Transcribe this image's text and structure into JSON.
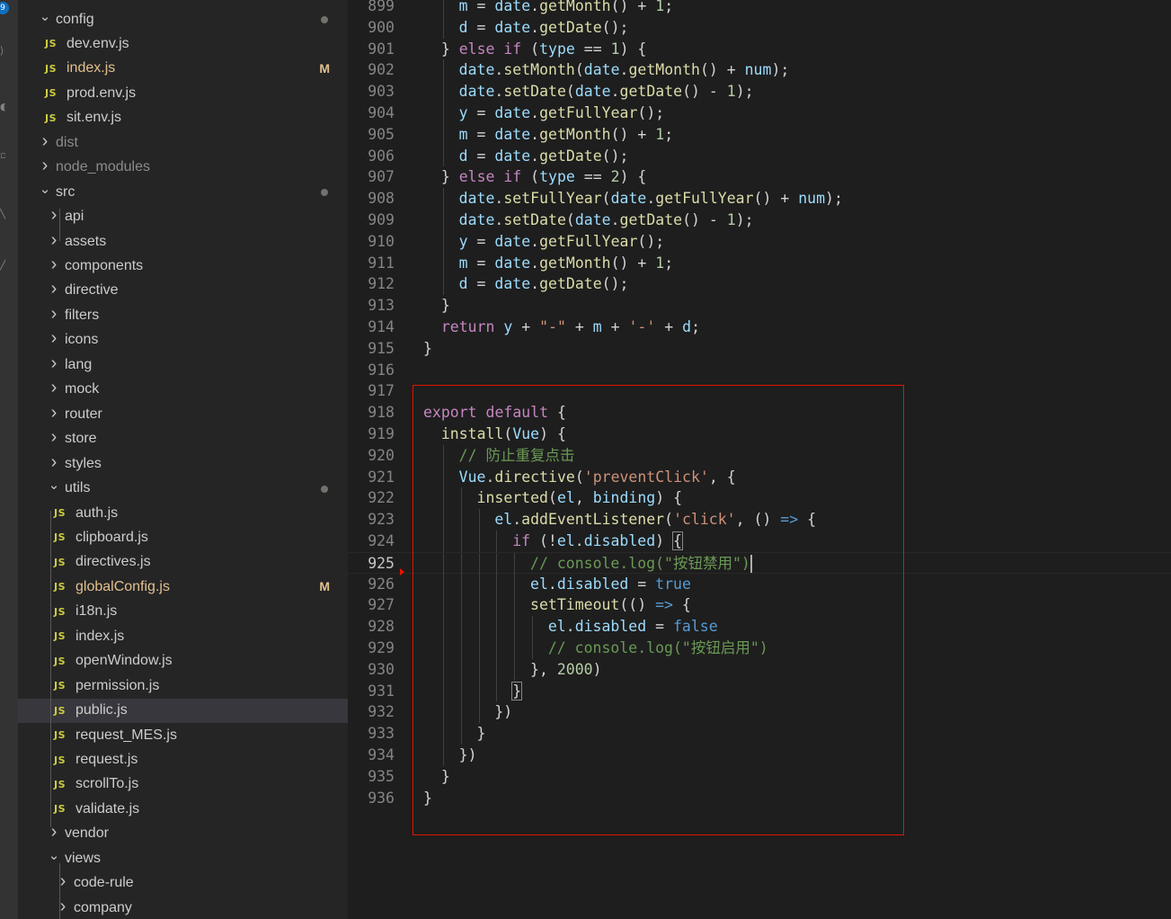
{
  "activity_bar": {
    "badge": "9"
  },
  "explorer": {
    "rows": [
      {
        "label": "config",
        "type": "folder-open",
        "depth": 1,
        "dot": true
      },
      {
        "label": "dev.env.js",
        "type": "js",
        "depth": 2
      },
      {
        "label": "index.js",
        "type": "js",
        "depth": 2,
        "modified": true,
        "badge": "M"
      },
      {
        "label": "prod.env.js",
        "type": "js",
        "depth": 2
      },
      {
        "label": "sit.env.js",
        "type": "js",
        "depth": 2
      },
      {
        "label": "dist",
        "type": "folder",
        "depth": 1,
        "dim": true
      },
      {
        "label": "node_modules",
        "type": "folder",
        "depth": 1,
        "dim": true
      },
      {
        "label": "src",
        "type": "folder-open",
        "depth": 1,
        "dot": true
      },
      {
        "label": "api",
        "type": "folder",
        "depth": 2
      },
      {
        "label": "assets",
        "type": "folder",
        "depth": 2
      },
      {
        "label": "components",
        "type": "folder",
        "depth": 2
      },
      {
        "label": "directive",
        "type": "folder",
        "depth": 2
      },
      {
        "label": "filters",
        "type": "folder",
        "depth": 2
      },
      {
        "label": "icons",
        "type": "folder",
        "depth": 2
      },
      {
        "label": "lang",
        "type": "folder",
        "depth": 2
      },
      {
        "label": "mock",
        "type": "folder",
        "depth": 2
      },
      {
        "label": "router",
        "type": "folder",
        "depth": 2
      },
      {
        "label": "store",
        "type": "folder",
        "depth": 2
      },
      {
        "label": "styles",
        "type": "folder",
        "depth": 2
      },
      {
        "label": "utils",
        "type": "folder-open",
        "depth": 2,
        "dot": true
      },
      {
        "label": "auth.js",
        "type": "js",
        "depth": 3
      },
      {
        "label": "clipboard.js",
        "type": "js",
        "depth": 3
      },
      {
        "label": "directives.js",
        "type": "js",
        "depth": 3
      },
      {
        "label": "globalConfig.js",
        "type": "js",
        "depth": 3,
        "modified": true,
        "badge": "M"
      },
      {
        "label": "i18n.js",
        "type": "js",
        "depth": 3
      },
      {
        "label": "index.js",
        "type": "js",
        "depth": 3
      },
      {
        "label": "openWindow.js",
        "type": "js",
        "depth": 3
      },
      {
        "label": "permission.js",
        "type": "js",
        "depth": 3
      },
      {
        "label": "public.js",
        "type": "js",
        "depth": 3,
        "selected": true
      },
      {
        "label": "request_MES.js",
        "type": "js",
        "depth": 3
      },
      {
        "label": "request.js",
        "type": "js",
        "depth": 3
      },
      {
        "label": "scrollTo.js",
        "type": "js",
        "depth": 3
      },
      {
        "label": "validate.js",
        "type": "js",
        "depth": 3
      },
      {
        "label": "vendor",
        "type": "folder",
        "depth": 2
      },
      {
        "label": "views",
        "type": "folder-open",
        "depth": 2
      },
      {
        "label": "code-rule",
        "type": "folder",
        "depth": 3
      },
      {
        "label": "company",
        "type": "folder",
        "depth": 3
      }
    ]
  },
  "editor": {
    "current_line": 925,
    "lines": [
      {
        "n": 899,
        "indent": 2,
        "t": [
          [
            "va",
            "m"
          ],
          [
            "op",
            " = "
          ],
          [
            "va",
            "date"
          ],
          [
            "op",
            "."
          ],
          [
            "fn",
            "getMonth"
          ],
          [
            "op",
            "() + "
          ],
          [
            "nu",
            "1"
          ],
          [
            "op",
            ";"
          ]
        ]
      },
      {
        "n": 900,
        "indent": 2,
        "t": [
          [
            "va",
            "d"
          ],
          [
            "op",
            " = "
          ],
          [
            "va",
            "date"
          ],
          [
            "op",
            "."
          ],
          [
            "fn",
            "getDate"
          ],
          [
            "op",
            "();"
          ]
        ]
      },
      {
        "n": 901,
        "indent": 1,
        "t": [
          [
            "op",
            "} "
          ],
          [
            "kw",
            "else if"
          ],
          [
            "op",
            " ("
          ],
          [
            "va",
            "type"
          ],
          [
            "op",
            " == "
          ],
          [
            "nu",
            "1"
          ],
          [
            "op",
            ") {"
          ]
        ]
      },
      {
        "n": 902,
        "indent": 2,
        "t": [
          [
            "va",
            "date"
          ],
          [
            "op",
            "."
          ],
          [
            "fn",
            "setMonth"
          ],
          [
            "op",
            "("
          ],
          [
            "va",
            "date"
          ],
          [
            "op",
            "."
          ],
          [
            "fn",
            "getMonth"
          ],
          [
            "op",
            "() + "
          ],
          [
            "va",
            "num"
          ],
          [
            "op",
            ");"
          ]
        ]
      },
      {
        "n": 903,
        "indent": 2,
        "t": [
          [
            "va",
            "date"
          ],
          [
            "op",
            "."
          ],
          [
            "fn",
            "setDate"
          ],
          [
            "op",
            "("
          ],
          [
            "va",
            "date"
          ],
          [
            "op",
            "."
          ],
          [
            "fn",
            "getDate"
          ],
          [
            "op",
            "() - "
          ],
          [
            "nu",
            "1"
          ],
          [
            "op",
            ");"
          ]
        ]
      },
      {
        "n": 904,
        "indent": 2,
        "t": [
          [
            "va",
            "y"
          ],
          [
            "op",
            " = "
          ],
          [
            "va",
            "date"
          ],
          [
            "op",
            "."
          ],
          [
            "fn",
            "getFullYear"
          ],
          [
            "op",
            "();"
          ]
        ]
      },
      {
        "n": 905,
        "indent": 2,
        "t": [
          [
            "va",
            "m"
          ],
          [
            "op",
            " = "
          ],
          [
            "va",
            "date"
          ],
          [
            "op",
            "."
          ],
          [
            "fn",
            "getMonth"
          ],
          [
            "op",
            "() + "
          ],
          [
            "nu",
            "1"
          ],
          [
            "op",
            ";"
          ]
        ]
      },
      {
        "n": 906,
        "indent": 2,
        "t": [
          [
            "va",
            "d"
          ],
          [
            "op",
            " = "
          ],
          [
            "va",
            "date"
          ],
          [
            "op",
            "."
          ],
          [
            "fn",
            "getDate"
          ],
          [
            "op",
            "();"
          ]
        ]
      },
      {
        "n": 907,
        "indent": 1,
        "t": [
          [
            "op",
            "} "
          ],
          [
            "kw",
            "else if"
          ],
          [
            "op",
            " ("
          ],
          [
            "va",
            "type"
          ],
          [
            "op",
            " == "
          ],
          [
            "nu",
            "2"
          ],
          [
            "op",
            ") {"
          ]
        ]
      },
      {
        "n": 908,
        "indent": 2,
        "t": [
          [
            "va",
            "date"
          ],
          [
            "op",
            "."
          ],
          [
            "fn",
            "setFullYear"
          ],
          [
            "op",
            "("
          ],
          [
            "va",
            "date"
          ],
          [
            "op",
            "."
          ],
          [
            "fn",
            "getFullYear"
          ],
          [
            "op",
            "() + "
          ],
          [
            "va",
            "num"
          ],
          [
            "op",
            ");"
          ]
        ]
      },
      {
        "n": 909,
        "indent": 2,
        "t": [
          [
            "va",
            "date"
          ],
          [
            "op",
            "."
          ],
          [
            "fn",
            "setDate"
          ],
          [
            "op",
            "("
          ],
          [
            "va",
            "date"
          ],
          [
            "op",
            "."
          ],
          [
            "fn",
            "getDate"
          ],
          [
            "op",
            "() - "
          ],
          [
            "nu",
            "1"
          ],
          [
            "op",
            ");"
          ]
        ]
      },
      {
        "n": 910,
        "indent": 2,
        "t": [
          [
            "va",
            "y"
          ],
          [
            "op",
            " = "
          ],
          [
            "va",
            "date"
          ],
          [
            "op",
            "."
          ],
          [
            "fn",
            "getFullYear"
          ],
          [
            "op",
            "();"
          ]
        ]
      },
      {
        "n": 911,
        "indent": 2,
        "t": [
          [
            "va",
            "m"
          ],
          [
            "op",
            " = "
          ],
          [
            "va",
            "date"
          ],
          [
            "op",
            "."
          ],
          [
            "fn",
            "getMonth"
          ],
          [
            "op",
            "() + "
          ],
          [
            "nu",
            "1"
          ],
          [
            "op",
            ";"
          ]
        ]
      },
      {
        "n": 912,
        "indent": 2,
        "t": [
          [
            "va",
            "d"
          ],
          [
            "op",
            " = "
          ],
          [
            "va",
            "date"
          ],
          [
            "op",
            "."
          ],
          [
            "fn",
            "getDate"
          ],
          [
            "op",
            "();"
          ]
        ]
      },
      {
        "n": 913,
        "indent": 1,
        "t": [
          [
            "op",
            "}"
          ]
        ]
      },
      {
        "n": 914,
        "indent": 1,
        "t": [
          [
            "kw",
            "return"
          ],
          [
            "op",
            " "
          ],
          [
            "va",
            "y"
          ],
          [
            "op",
            " + "
          ],
          [
            "st",
            "\"-\""
          ],
          [
            "op",
            " + "
          ],
          [
            "va",
            "m"
          ],
          [
            "op",
            " + "
          ],
          [
            "st",
            "'-'"
          ],
          [
            "op",
            " + "
          ],
          [
            "va",
            "d"
          ],
          [
            "op",
            ";"
          ]
        ]
      },
      {
        "n": 915,
        "indent": 0,
        "t": [
          [
            "op",
            "}"
          ]
        ]
      },
      {
        "n": 916,
        "indent": 0,
        "t": []
      },
      {
        "n": 917,
        "indent": 0,
        "t": []
      },
      {
        "n": 918,
        "indent": 0,
        "t": [
          [
            "kw",
            "export default"
          ],
          [
            "op",
            " {"
          ]
        ]
      },
      {
        "n": 919,
        "indent": 1,
        "t": [
          [
            "fn",
            "install"
          ],
          [
            "op",
            "("
          ],
          [
            "va",
            "Vue"
          ],
          [
            "op",
            ") {"
          ]
        ]
      },
      {
        "n": 920,
        "indent": 2,
        "t": [
          [
            "cm",
            "// 防止重复点击"
          ]
        ]
      },
      {
        "n": 921,
        "indent": 2,
        "t": [
          [
            "va",
            "Vue"
          ],
          [
            "op",
            "."
          ],
          [
            "fn",
            "directive"
          ],
          [
            "op",
            "("
          ],
          [
            "st",
            "'preventClick'"
          ],
          [
            "op",
            ", {"
          ]
        ]
      },
      {
        "n": 922,
        "indent": 3,
        "t": [
          [
            "fn",
            "inserted"
          ],
          [
            "op",
            "("
          ],
          [
            "va",
            "el"
          ],
          [
            "op",
            ", "
          ],
          [
            "va",
            "binding"
          ],
          [
            "op",
            ") {"
          ]
        ]
      },
      {
        "n": 923,
        "indent": 4,
        "t": [
          [
            "va",
            "el"
          ],
          [
            "op",
            "."
          ],
          [
            "fn",
            "addEventListener"
          ],
          [
            "op",
            "("
          ],
          [
            "st",
            "'click'"
          ],
          [
            "op",
            ", () "
          ],
          [
            "ar",
            "=>"
          ],
          [
            "op",
            " {"
          ]
        ]
      },
      {
        "n": 924,
        "indent": 5,
        "t": [
          [
            "kw",
            "if"
          ],
          [
            "op",
            " (!"
          ],
          [
            "va",
            "el"
          ],
          [
            "op",
            "."
          ],
          [
            "va",
            "disabled"
          ],
          [
            "op",
            ") "
          ],
          [
            "bm",
            "{"
          ]
        ]
      },
      {
        "n": 925,
        "indent": 6,
        "t": [
          [
            "cm",
            "// console.log(\"按钮禁用\")"
          ],
          [
            "cur",
            ""
          ]
        ]
      },
      {
        "n": 926,
        "indent": 6,
        "t": [
          [
            "va",
            "el"
          ],
          [
            "op",
            "."
          ],
          [
            "va",
            "disabled"
          ],
          [
            "op",
            " = "
          ],
          [
            "bl",
            "true"
          ]
        ]
      },
      {
        "n": 927,
        "indent": 6,
        "t": [
          [
            "fn",
            "setTimeout"
          ],
          [
            "op",
            "(() "
          ],
          [
            "ar",
            "=>"
          ],
          [
            "op",
            " {"
          ]
        ]
      },
      {
        "n": 928,
        "indent": 7,
        "t": [
          [
            "va",
            "el"
          ],
          [
            "op",
            "."
          ],
          [
            "va",
            "disabled"
          ],
          [
            "op",
            " = "
          ],
          [
            "bl",
            "false"
          ]
        ]
      },
      {
        "n": 929,
        "indent": 7,
        "t": [
          [
            "cm",
            "// console.log(\"按钮启用\")"
          ]
        ]
      },
      {
        "n": 930,
        "indent": 6,
        "t": [
          [
            "op",
            "}, "
          ],
          [
            "nu",
            "2000"
          ],
          [
            "op",
            ")"
          ]
        ]
      },
      {
        "n": 931,
        "indent": 5,
        "t": [
          [
            "bm",
            "}"
          ]
        ]
      },
      {
        "n": 932,
        "indent": 4,
        "t": [
          [
            "op",
            "})"
          ]
        ]
      },
      {
        "n": 933,
        "indent": 3,
        "t": [
          [
            "op",
            "}"
          ]
        ]
      },
      {
        "n": 934,
        "indent": 2,
        "t": [
          [
            "op",
            "})"
          ]
        ]
      },
      {
        "n": 935,
        "indent": 1,
        "t": [
          [
            "op",
            "}"
          ]
        ]
      },
      {
        "n": 936,
        "indent": 0,
        "t": [
          [
            "op",
            "}"
          ]
        ]
      }
    ]
  },
  "colors": {
    "sidebar_bg": "#252526",
    "editor_bg": "#1e1e1e",
    "highlight_box": "#e51400",
    "modified": "#e2c08d",
    "js_icon": "#cbcb41"
  }
}
